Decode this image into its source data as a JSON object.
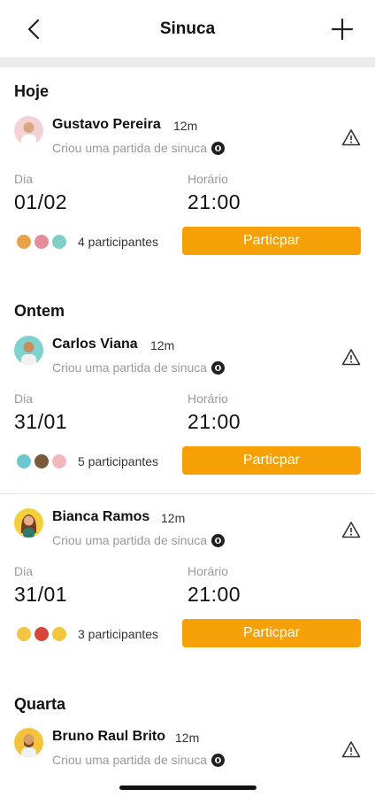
{
  "header": {
    "title": "Sinuca",
    "back_icon": "chevron-left-icon",
    "add_icon": "plus-icon"
  },
  "sections": [
    {
      "title": "Hoje"
    },
    {
      "title": "Ontem"
    },
    {
      "title": "Quarta"
    }
  ],
  "posts": [
    {
      "name": "Gustavo Pereira",
      "time": "12m",
      "subtitle": "Criou uma partida de sinuca",
      "day_label": "Dia",
      "day": "01/02",
      "time_label": "Horário",
      "hour": "21:00",
      "participants": "4 participantes",
      "button": "Particpar"
    },
    {
      "name": "Carlos Viana",
      "time": "12m",
      "subtitle": "Criou uma partida de sinuca",
      "day_label": "Dia",
      "day": "31/01",
      "time_label": "Horário",
      "hour": "21:00",
      "participants": "5 participantes",
      "button": "Particpar"
    },
    {
      "name": "Bianca Ramos",
      "time": "12m",
      "subtitle": "Criou uma partida de sinuca",
      "day_label": "Dia",
      "day": "31/01",
      "time_label": "Horário",
      "hour": "21:00",
      "participants": "3 participantes",
      "button": "Particpar"
    },
    {
      "name": "Bruno Raul Brito",
      "time": "12m",
      "subtitle": "Criou uma partida de sinuca"
    }
  ],
  "colors": {
    "accent": "#f5a007",
    "muted_text": "#9a9a9a"
  }
}
